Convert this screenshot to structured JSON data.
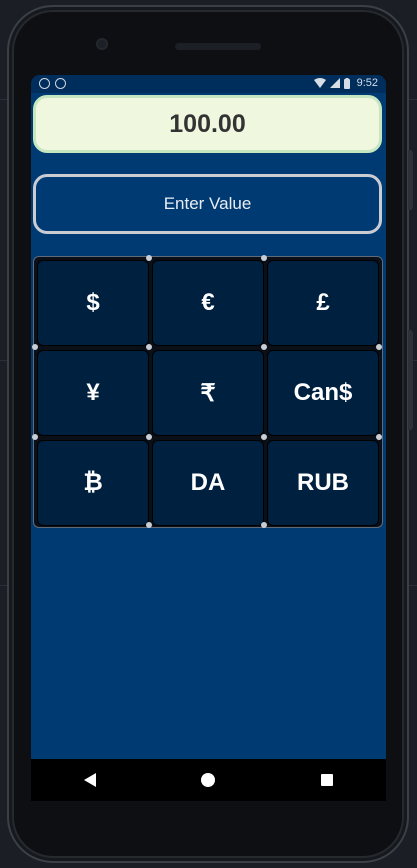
{
  "status_bar": {
    "time": "9:52",
    "icons": [
      "notification-a-icon",
      "notification-circle-icon",
      "wifi-icon",
      "signal-icon",
      "battery-icon"
    ]
  },
  "value_display": "100.00",
  "enter_button_label": "Enter Value",
  "currencies": [
    "$",
    "€",
    "£",
    "¥",
    "₹",
    "Can$",
    "₿",
    "DA",
    "RUB"
  ],
  "nav": {
    "icons": [
      "back-icon",
      "home-icon",
      "recents-icon"
    ]
  },
  "colors": {
    "screen_bg": "#003a73",
    "value_bg": "#eff7de",
    "cell_bg": "#00203f"
  }
}
